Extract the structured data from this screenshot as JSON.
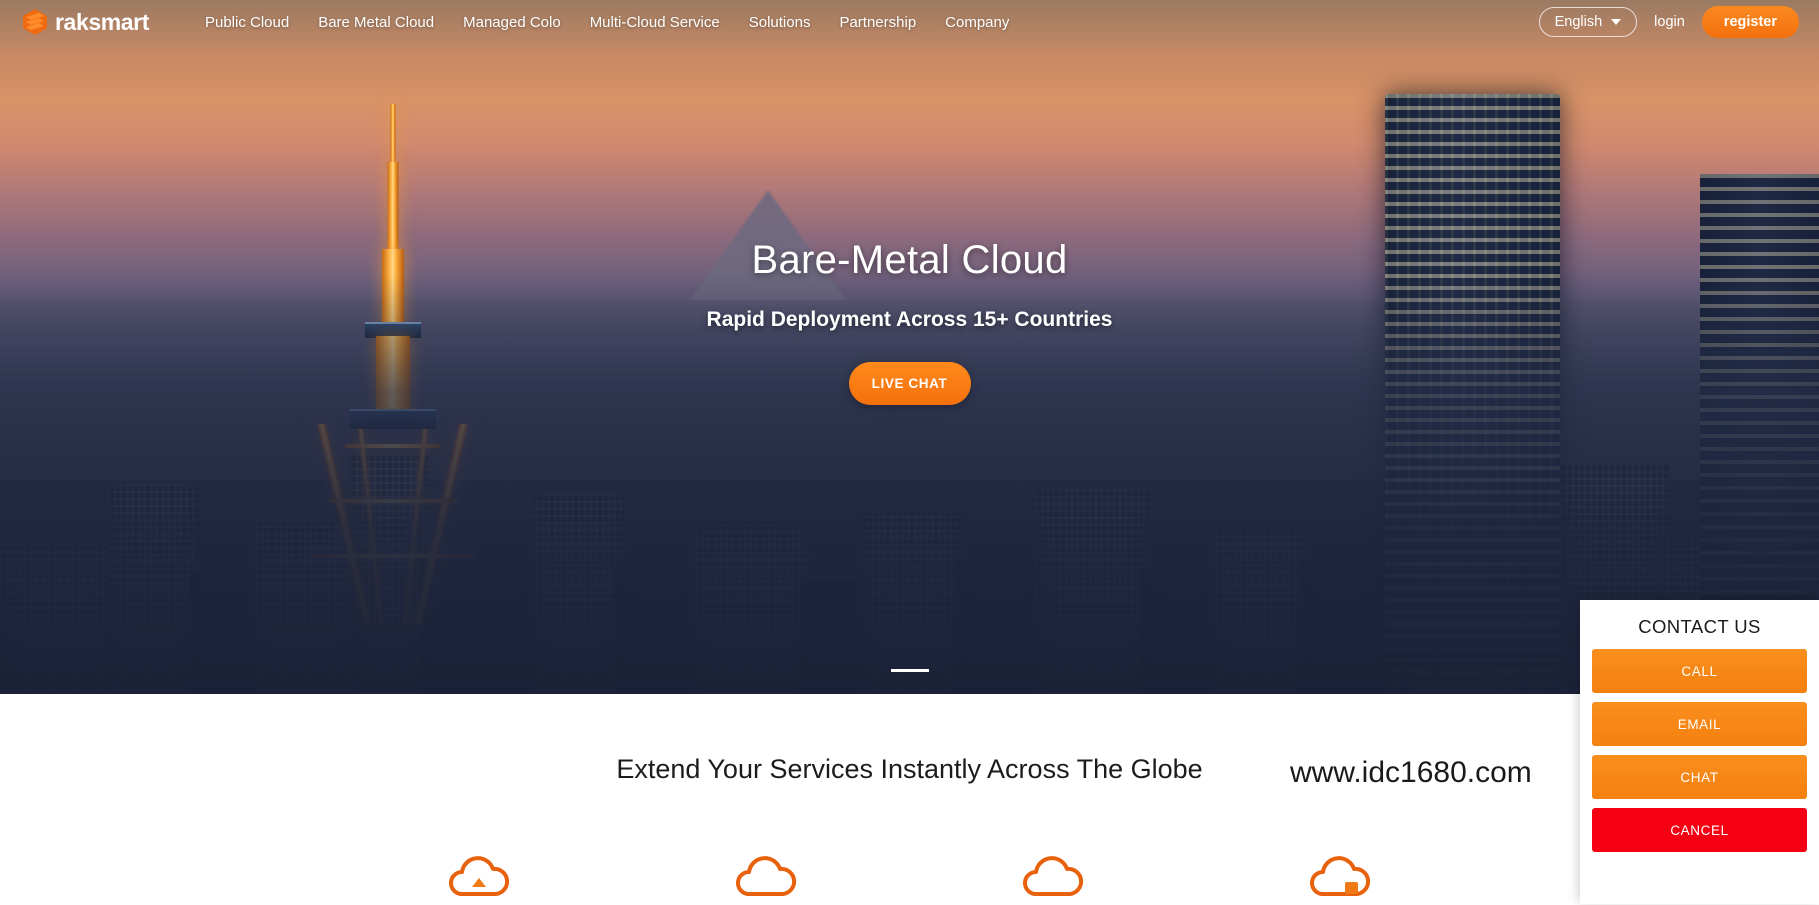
{
  "navbar": {
    "logo_text": "raksmart",
    "logo_icon": "raksmart-hexagon-logo",
    "links": [
      {
        "label": "Public Cloud"
      },
      {
        "label": "Bare Metal Cloud"
      },
      {
        "label": "Managed Colo"
      },
      {
        "label": "Multi-Cloud Service"
      },
      {
        "label": "Solutions"
      },
      {
        "label": "Partnership"
      },
      {
        "label": "Company"
      }
    ],
    "language": {
      "selected": "English",
      "caret_icon": "chevron-down-icon"
    },
    "login_label": "login",
    "register_label": "register"
  },
  "hero": {
    "title": "Bare-Metal Cloud",
    "subtitle": "Rapid Deployment Across 15+ Countries",
    "cta_label": "LIVE CHAT",
    "carousel": {
      "total": 1,
      "active_index": 0
    }
  },
  "lower": {
    "heading": "Extend Your Services Instantly Across The Globe",
    "watermark": "www.idc1680.com",
    "feature_icons": [
      {
        "icon": "cloud-upload-icon"
      },
      {
        "icon": "cloud-icon"
      },
      {
        "icon": "cloud-icon"
      },
      {
        "icon": "cloud-lock-icon"
      }
    ]
  },
  "contact_panel": {
    "title": "CONTACT US",
    "buttons": [
      {
        "label": "CALL",
        "style": "orange"
      },
      {
        "label": "EMAIL",
        "style": "orange"
      },
      {
        "label": "CHAT",
        "style": "orange"
      },
      {
        "label": "CANCEL",
        "style": "red"
      }
    ]
  },
  "colors": {
    "brand_orange": "#f4800f",
    "register_orange": "#fb8a21",
    "cancel_red": "#f50012",
    "hero_text": "#ffffff",
    "heading_dark": "#1c1c1c"
  }
}
